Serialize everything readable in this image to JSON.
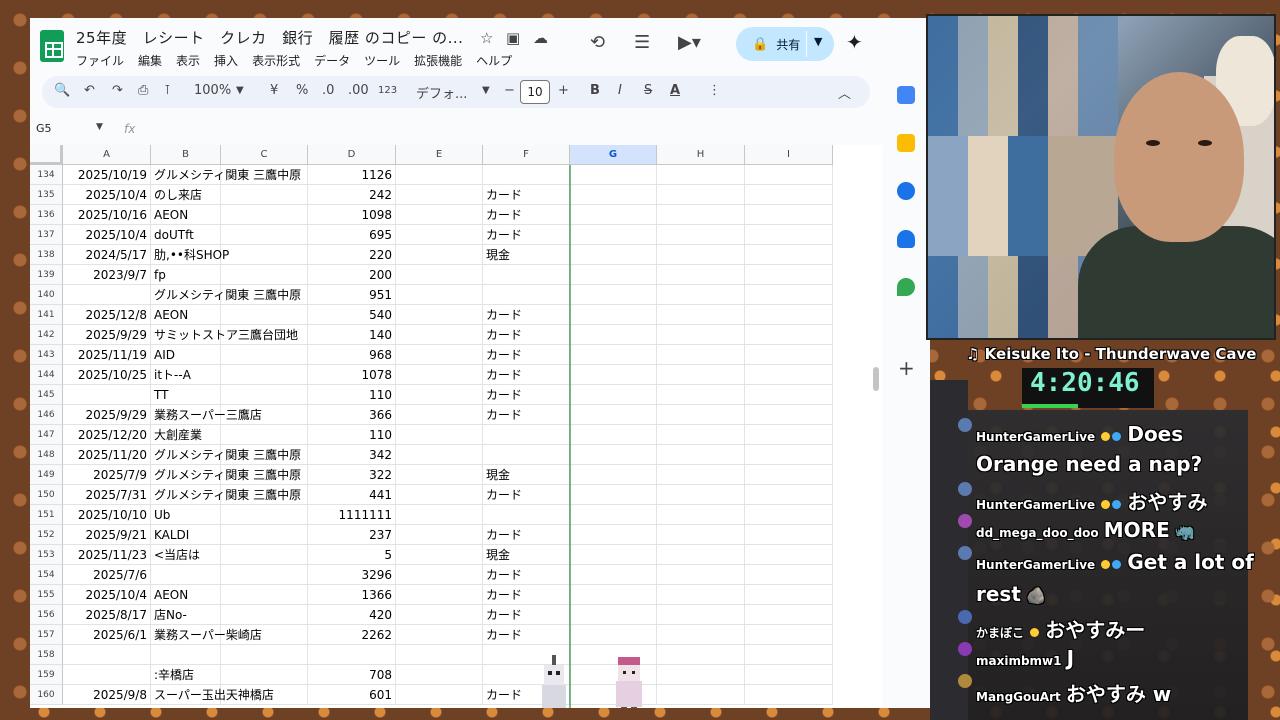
{
  "sheets": {
    "title": "25年度　レシート　クレカ　銀行　履歴 のコピー の...",
    "menu": [
      "ファイル",
      "編集",
      "表示",
      "挿入",
      "表示形式",
      "データ",
      "ツール",
      "拡張機能",
      "ヘルプ"
    ],
    "share_label": "共有",
    "toolbar": {
      "zoom": "100%",
      "currency": "¥",
      "percent": "%",
      "dec_decrease": ".0",
      "dec_increase": ".00",
      "number_format": "123",
      "font": "デフォ...",
      "font_size": "10",
      "bold": "B",
      "italic": "I",
      "strike": "S",
      "text_color": "A"
    },
    "namebox": "G5",
    "fx": "fx",
    "columns": [
      "A",
      "B",
      "C",
      "D",
      "E",
      "F",
      "G",
      "H",
      "I"
    ],
    "rows": [
      {
        "n": "134",
        "a": "2025/10/19",
        "b": "グルメシティ関東 三鷹中原",
        "d": "1126",
        "f": ""
      },
      {
        "n": "135",
        "a": "2025/10/4",
        "b": "のし来店",
        "d": "242",
        "f": "カード"
      },
      {
        "n": "136",
        "a": "2025/10/16",
        "b": "AEON",
        "d": "1098",
        "f": "カード"
      },
      {
        "n": "137",
        "a": "2025/10/4",
        "b": "doUTft",
        "d": "695",
        "f": "カード"
      },
      {
        "n": "138",
        "a": "2024/5/17",
        "b": "肋,••科SHOP",
        "d": "220",
        "f": "現金"
      },
      {
        "n": "139",
        "a": "2023/9/7",
        "b": "fp",
        "d": "200",
        "f": ""
      },
      {
        "n": "140",
        "a": "",
        "b": "グルメシティ関東 三鷹中原",
        "d": "951",
        "f": ""
      },
      {
        "n": "141",
        "a": "2025/12/8",
        "b": "AEON",
        "d": "540",
        "f": "カード"
      },
      {
        "n": "142",
        "a": "2025/9/29",
        "b": "サミットストア三鷹台団地",
        "d": "140",
        "f": "カード"
      },
      {
        "n": "143",
        "a": "2025/11/19",
        "b": "AID",
        "d": "968",
        "f": "カード"
      },
      {
        "n": "144",
        "a": "2025/10/25",
        "b": "itト--A",
        "d": "1078",
        "f": "カード"
      },
      {
        "n": "145",
        "a": "",
        "b": "TT",
        "d": "110",
        "f": "カード"
      },
      {
        "n": "146",
        "a": "2025/9/29",
        "b": "業務スーパー三鷹店",
        "d": "366",
        "f": "カード"
      },
      {
        "n": "147",
        "a": "2025/12/20",
        "b": "大創産業",
        "d": "110",
        "f": ""
      },
      {
        "n": "148",
        "a": "2025/11/20",
        "b": "グルメシティ関東 三鷹中原",
        "d": "342",
        "f": ""
      },
      {
        "n": "149",
        "a": "2025/7/9",
        "b": "グルメシティ関東 三鷹中原",
        "d": "322",
        "f": "現金"
      },
      {
        "n": "150",
        "a": "2025/7/31",
        "b": "グルメシティ関東 三鷹中原",
        "d": "441",
        "f": "カード"
      },
      {
        "n": "151",
        "a": "2025/10/10",
        "b": "Ub",
        "d": "1111111",
        "f": ""
      },
      {
        "n": "152",
        "a": "2025/9/21",
        "b": "KALDI",
        "d": "237",
        "f": "カード"
      },
      {
        "n": "153",
        "a": "2025/11/23",
        "b": "<当店は",
        "d": "5",
        "f": "現金"
      },
      {
        "n": "154",
        "a": "2025/7/6",
        "b": "",
        "d": "3296",
        "f": "カード"
      },
      {
        "n": "155",
        "a": "2025/10/4",
        "b": "AEON",
        "d": "1366",
        "f": "カード"
      },
      {
        "n": "156",
        "a": "2025/8/17",
        "b": "店No-",
        "d": "420",
        "f": "カード"
      },
      {
        "n": "157",
        "a": "2025/6/1",
        "b": "業務スーパー柴崎店",
        "d": "2262",
        "f": "カード"
      },
      {
        "n": "158",
        "a": "",
        "b": "",
        "d": "",
        "f": ""
      },
      {
        "n": "159",
        "a": "",
        "b": ":辛橋店",
        "d": "708",
        "f": ""
      },
      {
        "n": "160",
        "a": "2025/9/8",
        "b": "スーパー玉出天神橋店",
        "d": "601",
        "f": "カード"
      }
    ]
  },
  "stream": {
    "song": "♫ Keisuke Ito - Thunderwave Cave",
    "timer": "4:20:46",
    "chat": [
      {
        "user": "HunterGamerLive",
        "msg": "Does"
      },
      {
        "user": "",
        "msg": "Orange need a nap?"
      },
      {
        "user": "HunterGamerLive",
        "msg": "おやすみ"
      },
      {
        "user": "dd_mega_doo_doo",
        "msg": "MORE"
      },
      {
        "user": "HunterGamerLive",
        "msg": "Get a lot of"
      },
      {
        "user": "",
        "msg": "rest"
      },
      {
        "user": "かまぼこ",
        "msg": "おやすみー"
      },
      {
        "user": "maximbmw1",
        "msg": "J"
      },
      {
        "user": "MangGouArt",
        "msg": "おやすみ w"
      }
    ],
    "colors": {
      "timer": "#7ff0d0",
      "timer_bar": "#39d353",
      "share_bg": "#c2e7ff",
      "sheets_green": "#0f9d58"
    }
  }
}
